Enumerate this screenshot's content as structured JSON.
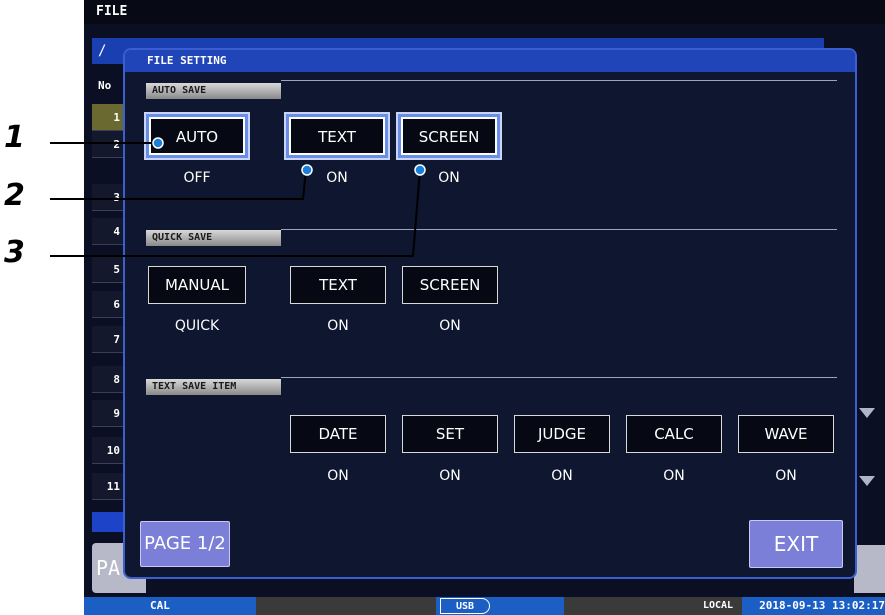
{
  "window": {
    "title": "FILE",
    "path": "/",
    "list_header": "No"
  },
  "file_rows": [
    "1",
    "2",
    "3",
    "4",
    "5",
    "6",
    "7",
    "8",
    "9",
    "10",
    "11"
  ],
  "background": {
    "page_button_fragment": "PA"
  },
  "status": {
    "cal": "CAL",
    "usb": "USB",
    "local": "LOCAL",
    "datetime": "2018-09-13 13:02:17"
  },
  "dialog": {
    "title": "FILE SETTING",
    "auto_save": {
      "label": "AUTO SAVE",
      "buttons": [
        {
          "label": "AUTO",
          "value": "OFF"
        },
        {
          "label": "TEXT",
          "value": "ON"
        },
        {
          "label": "SCREEN",
          "value": "ON"
        }
      ]
    },
    "quick_save": {
      "label": "QUICK SAVE",
      "buttons": [
        {
          "label": "MANUAL",
          "value": "QUICK"
        },
        {
          "label": "TEXT",
          "value": "ON"
        },
        {
          "label": "SCREEN",
          "value": "ON"
        }
      ]
    },
    "text_save_item": {
      "label": "TEXT SAVE ITEM",
      "buttons": [
        {
          "label": "DATE",
          "value": "ON"
        },
        {
          "label": "SET",
          "value": "ON"
        },
        {
          "label": "JUDGE",
          "value": "ON"
        },
        {
          "label": "CALC",
          "value": "ON"
        },
        {
          "label": "WAVE",
          "value": "ON"
        }
      ]
    },
    "page_label": "PAGE 1/2",
    "exit_label": "EXIT"
  },
  "callouts": [
    "1",
    "2",
    "3"
  ],
  "colors": {
    "dialog_border": "#3b5fd0",
    "highlight": "#6a8ee8",
    "purple_button": "#7b7fd8",
    "status_blue": "#1c5fc4"
  }
}
